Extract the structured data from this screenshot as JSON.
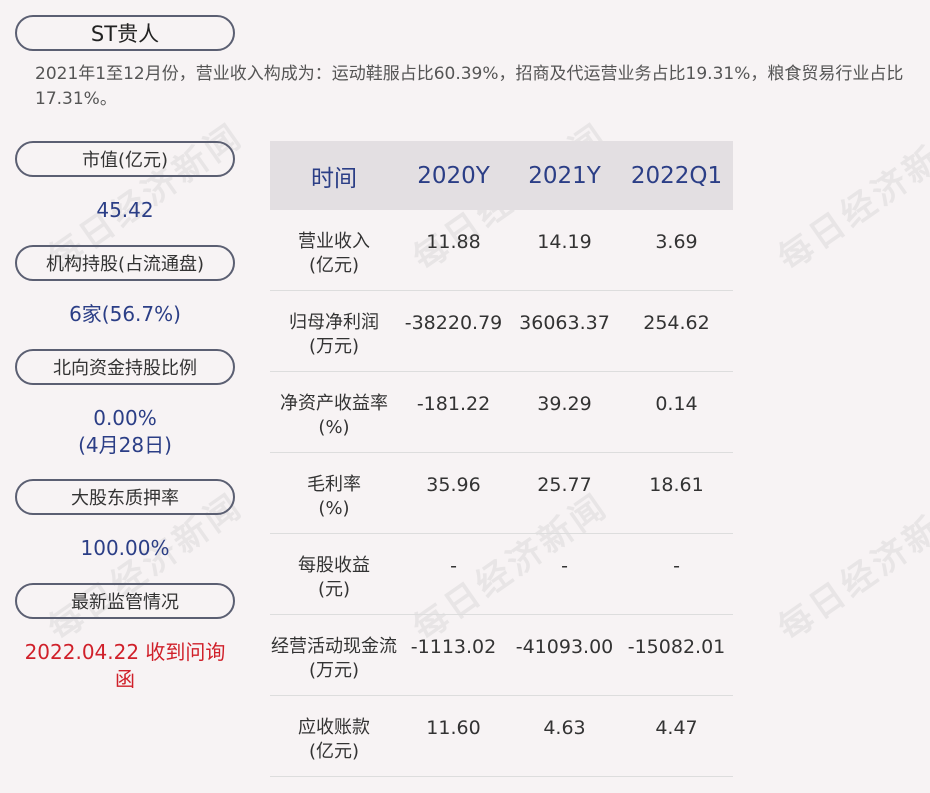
{
  "company": "ST贵人",
  "summary": "2021年1至12月份，营业收入构成为：运动鞋服占比60.39%，招商及代运营业务占比19.31%，粮食贸易行业占比17.31%。",
  "left": {
    "market_cap_label": "市值(亿元)",
    "market_cap_value": "45.42",
    "inst_label": "机构持股(占流通盘)",
    "inst_value": "6家(56.7%)",
    "north_label": "北向资金持股比例",
    "north_value": "0.00%",
    "north_date": "(4月28日)",
    "pledge_label": "大股东质押率",
    "pledge_value": "100.00%",
    "reg_label": "最新监管情况",
    "reg_value": "2022.04.22 收到问询函"
  },
  "table": {
    "headers": [
      "时间",
      "2020Y",
      "2021Y",
      "2022Q1"
    ],
    "rows": [
      {
        "label": "营业收入",
        "unit": "(亿元)",
        "values": [
          "11.88",
          "14.19",
          "3.69"
        ]
      },
      {
        "label": "归母净利润",
        "unit": "(万元)",
        "values": [
          "-38220.79",
          "36063.37",
          "254.62"
        ]
      },
      {
        "label": "净资产收益率",
        "unit": "(%)",
        "values": [
          "-181.22",
          "39.29",
          "0.14"
        ]
      },
      {
        "label": "毛利率",
        "unit": "(%)",
        "values": [
          "35.96",
          "25.77",
          "18.61"
        ]
      },
      {
        "label": "每股收益",
        "unit": "(元)",
        "values": [
          "-",
          "-",
          "-"
        ]
      },
      {
        "label": "经营活动现金流",
        "unit": "(万元)",
        "values": [
          "-1113.02",
          "-41093.00",
          "-15082.01"
        ]
      },
      {
        "label": "应收账款",
        "unit": "(亿元)",
        "values": [
          "11.60",
          "4.63",
          "4.47"
        ]
      }
    ]
  },
  "watermark": "每日经济新闻"
}
